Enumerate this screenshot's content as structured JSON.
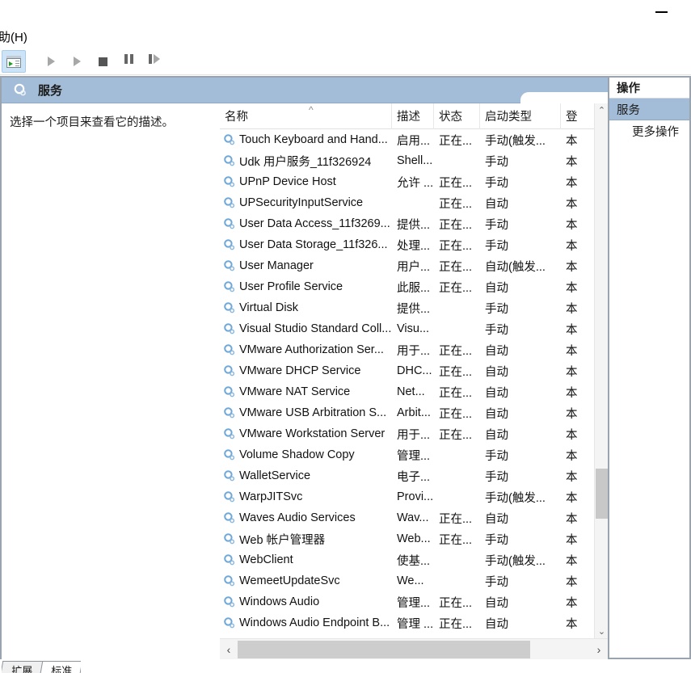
{
  "window": {
    "minimize_label": "—"
  },
  "menubar": {
    "items": [
      {
        "label": "助(H)",
        "name": "menu-help"
      }
    ]
  },
  "toolbar": {
    "buttons": [
      {
        "name": "show-console-tree-button",
        "icon": "console-tree-icon",
        "tooltip": "显示/隐藏控制台树",
        "active": true
      },
      {
        "name": "start-service-button",
        "icon": "play-icon",
        "tooltip": "启动服务"
      },
      {
        "name": "resume-service-button",
        "icon": "play-icon",
        "tooltip": "恢复服务"
      },
      {
        "name": "stop-service-button",
        "icon": "stop-icon",
        "tooltip": "停止服务"
      },
      {
        "name": "pause-service-button",
        "icon": "pause-icon",
        "tooltip": "暂停服务"
      },
      {
        "name": "restart-service-button",
        "icon": "restart-icon",
        "tooltip": "重新启动服务"
      }
    ]
  },
  "pane": {
    "header_title": "服务",
    "header_icon": "services-gear-icon",
    "description_placeholder": "选择一个项目来查看它的描述。"
  },
  "columns": [
    {
      "key": "name",
      "label": "名称",
      "sorted": "asc",
      "sort_caret": "^"
    },
    {
      "key": "desc",
      "label": "描述"
    },
    {
      "key": "state",
      "label": "状态"
    },
    {
      "key": "start",
      "label": "启动类型"
    },
    {
      "key": "logon",
      "label": "登"
    }
  ],
  "rows": [
    {
      "icon": "service-gear-icon",
      "name": "Touch Keyboard and Hand...",
      "desc": "启用...",
      "state": "正在...",
      "start": "手动(触发...",
      "logon": "本"
    },
    {
      "icon": "service-gear-icon",
      "name": "Udk 用户服务_11f326924",
      "desc": "Shell...",
      "state": "",
      "start": "手动",
      "logon": "本"
    },
    {
      "icon": "service-gear-icon",
      "name": "UPnP Device Host",
      "desc": "允许 ...",
      "state": "正在...",
      "start": "手动",
      "logon": "本"
    },
    {
      "icon": "service-gear-icon",
      "name": "UPSecurityInputService",
      "desc": "",
      "state": "正在...",
      "start": "自动",
      "logon": "本"
    },
    {
      "icon": "service-gear-icon",
      "name": "User Data Access_11f3269...",
      "desc": "提供...",
      "state": "正在...",
      "start": "手动",
      "logon": "本"
    },
    {
      "icon": "service-gear-icon",
      "name": "User Data Storage_11f326...",
      "desc": "处理...",
      "state": "正在...",
      "start": "手动",
      "logon": "本"
    },
    {
      "icon": "service-gear-icon",
      "name": "User Manager",
      "desc": "用户...",
      "state": "正在...",
      "start": "自动(触发...",
      "logon": "本"
    },
    {
      "icon": "service-gear-icon",
      "name": "User Profile Service",
      "desc": "此服...",
      "state": "正在...",
      "start": "自动",
      "logon": "本"
    },
    {
      "icon": "service-gear-icon",
      "name": "Virtual Disk",
      "desc": "提供...",
      "state": "",
      "start": "手动",
      "logon": "本"
    },
    {
      "icon": "service-gear-icon",
      "name": "Visual Studio Standard Coll...",
      "desc": "Visu...",
      "state": "",
      "start": "手动",
      "logon": "本"
    },
    {
      "icon": "service-gear-icon",
      "name": "VMware Authorization Ser...",
      "desc": "用于...",
      "state": "正在...",
      "start": "自动",
      "logon": "本"
    },
    {
      "icon": "service-gear-icon",
      "name": "VMware DHCP Service",
      "desc": "DHC...",
      "state": "正在...",
      "start": "自动",
      "logon": "本"
    },
    {
      "icon": "service-gear-icon",
      "name": "VMware NAT Service",
      "desc": "Net...",
      "state": "正在...",
      "start": "自动",
      "logon": "本"
    },
    {
      "icon": "service-gear-icon",
      "name": "VMware USB Arbitration S...",
      "desc": "Arbit...",
      "state": "正在...",
      "start": "自动",
      "logon": "本"
    },
    {
      "icon": "service-gear-icon",
      "name": "VMware Workstation Server",
      "desc": "用于...",
      "state": "正在...",
      "start": "自动",
      "logon": "本"
    },
    {
      "icon": "service-gear-icon",
      "name": "Volume Shadow Copy",
      "desc": "管理...",
      "state": "",
      "start": "手动",
      "logon": "本"
    },
    {
      "icon": "service-gear-icon",
      "name": "WalletService",
      "desc": "电子...",
      "state": "",
      "start": "手动",
      "logon": "本"
    },
    {
      "icon": "service-gear-icon",
      "name": "WarpJITSvc",
      "desc": "Provi...",
      "state": "",
      "start": "手动(触发...",
      "logon": "本"
    },
    {
      "icon": "service-gear-icon",
      "name": "Waves Audio Services",
      "desc": "Wav...",
      "state": "正在...",
      "start": "自动",
      "logon": "本"
    },
    {
      "icon": "service-gear-icon",
      "name": "Web 帐户管理器",
      "desc": "Web...",
      "state": "正在...",
      "start": "手动",
      "logon": "本"
    },
    {
      "icon": "service-gear-icon",
      "name": "WebClient",
      "desc": "使基...",
      "state": "",
      "start": "手动(触发...",
      "logon": "本"
    },
    {
      "icon": "service-gear-icon",
      "name": "WemeetUpdateSvc",
      "desc": "We...",
      "state": "",
      "start": "手动",
      "logon": "本"
    },
    {
      "icon": "service-gear-icon",
      "name": "Windows Audio",
      "desc": "管理...",
      "state": "正在...",
      "start": "自动",
      "logon": "本"
    },
    {
      "icon": "service-gear-icon",
      "name": "Windows Audio Endpoint B...",
      "desc": "管理 ...",
      "state": "正在...",
      "start": "自动",
      "logon": "本"
    }
  ],
  "scrollbars": {
    "vertical_up": "⌃",
    "vertical_down": "⌄",
    "horizontal_left": "‹",
    "horizontal_right": "›"
  },
  "view_tabs": [
    {
      "label": "扩展",
      "selected": false
    },
    {
      "label": "标准",
      "selected": true
    }
  ],
  "actions": {
    "header": "操作",
    "group": "服务",
    "items": [
      {
        "label": "更多操作"
      }
    ]
  },
  "colors": {
    "header_blue": "#a3bcd7",
    "toolbar_active": "#cde4f7",
    "frame_border": "#9aa4ae",
    "scroll_thumb": "#c8c8c8"
  }
}
